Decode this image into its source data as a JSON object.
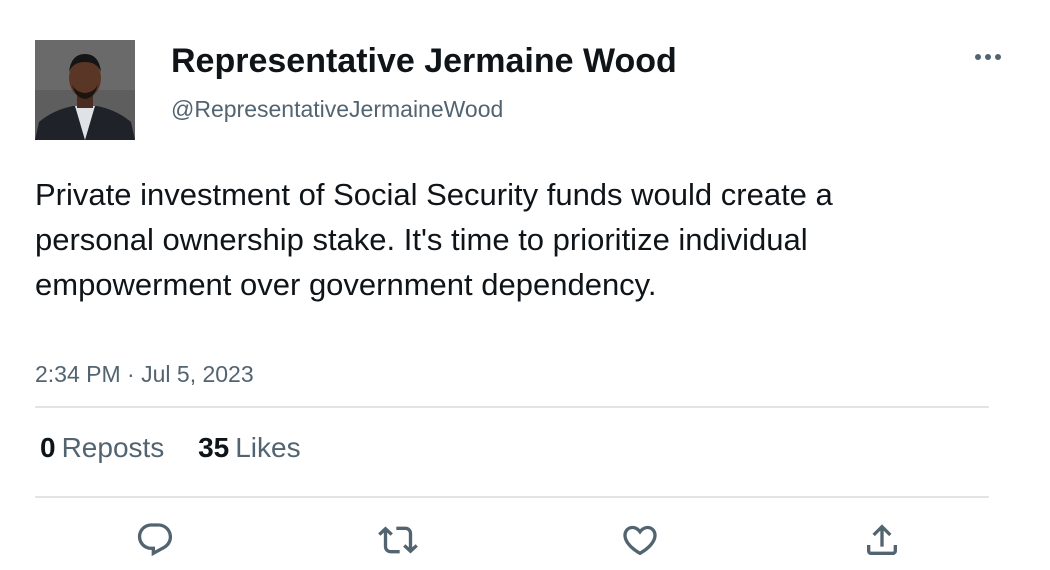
{
  "author": {
    "display_name": "Representative Jermaine Wood",
    "handle": "@RepresentativeJermaineWood"
  },
  "tweet": {
    "text": "Private investment of Social Security funds would create a personal ownership stake. It's time to prioritize individual empowerment over government dependency.",
    "time": "2:34 PM",
    "separator": "·",
    "date": "Jul 5, 2023"
  },
  "stats": {
    "reposts_count": "0",
    "reposts_label": "Reposts",
    "likes_count": "35",
    "likes_label": "Likes"
  },
  "icons": {
    "more": "more-horizontal-icon",
    "reply": "reply-icon",
    "repost": "repost-icon",
    "like": "heart-icon",
    "share": "share-icon"
  },
  "colors": {
    "text_primary": "#0f1419",
    "text_secondary": "#536471",
    "divider": "#e1e4e6"
  }
}
